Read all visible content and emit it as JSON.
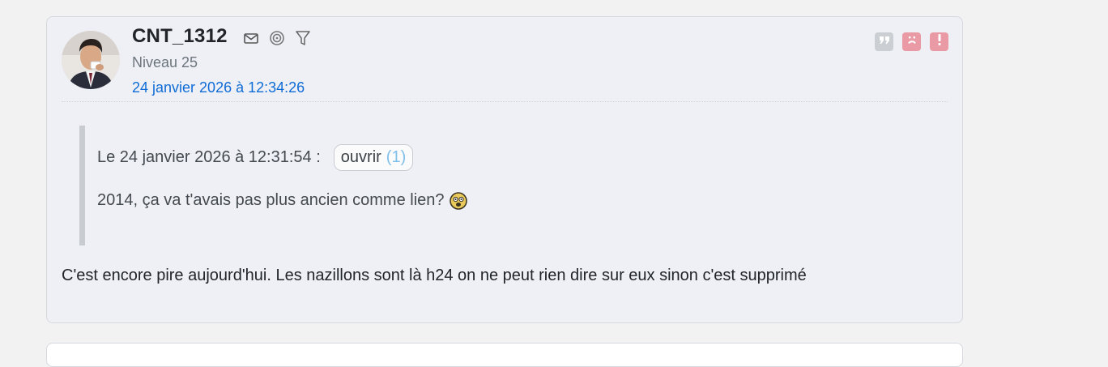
{
  "post": {
    "username": "CNT_1312",
    "level": "Niveau 25",
    "date": "24 janvier 2026 à 12:34:26",
    "user_icons": [
      "mail-icon",
      "spiral-icon",
      "filter-icon"
    ],
    "actions": [
      {
        "icon": "quote-icon",
        "color": "#c9ccd1"
      },
      {
        "icon": "sad-face-icon",
        "color": "#e99aa4"
      },
      {
        "icon": "report-icon",
        "color": "#e99aa4"
      }
    ],
    "quote": {
      "header": "Le 24 janvier 2026 à 12:31:54 :",
      "open_label": "ouvrir",
      "open_count": "(1)",
      "text": "2014, ça va t'avais pas plus ancien comme lien?"
    },
    "message": "C'est encore pire aujourd'hui. Les nazillons sont là h24 on ne peut rien dire sur eux sinon c'est supprimé"
  },
  "colors": {
    "link": "#0f6cd6",
    "post_background": "#eef0f5",
    "quote_bar": "#c8cbd0"
  }
}
